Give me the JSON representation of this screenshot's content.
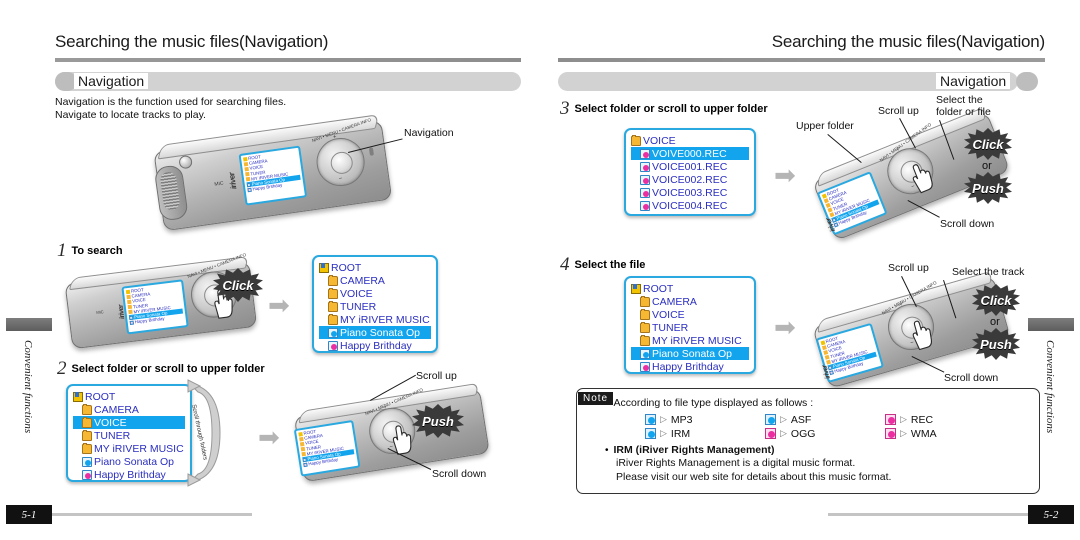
{
  "left_page": {
    "title": "Searching the music files(Navigation)",
    "section_label": "Navigation",
    "intro": "Navigation is the function used for searching files.\nNavigate to locate tracks to play.",
    "callout_navigation": "Navigation",
    "steps": [
      {
        "num": "1",
        "text": "To search"
      },
      {
        "num": "2",
        "text": "Select folder or scroll to upper folder"
      }
    ],
    "labels": {
      "click": "Click",
      "push": "Push",
      "scroll_up": "Scroll up",
      "scroll_down": "Scroll down",
      "scroll_through_folders": "Scroll through folders"
    },
    "screen_step1": {
      "rows": [
        {
          "icon": "root-icon",
          "text": "ROOT",
          "selected": false,
          "indent": false
        },
        {
          "icon": "folder-icon",
          "text": "CAMERA",
          "selected": false,
          "indent": true
        },
        {
          "icon": "folder-icon",
          "text": "VOICE",
          "selected": false,
          "indent": true
        },
        {
          "icon": "folder-icon",
          "text": "TUNER",
          "selected": false,
          "indent": true
        },
        {
          "icon": "folder-icon",
          "text": "MY iRIVER MUSIC",
          "selected": false,
          "indent": true
        },
        {
          "icon": "music-file-icon",
          "text": "Piano Sonata Op",
          "selected": true,
          "indent": true
        },
        {
          "icon": "music-file-icon-magenta",
          "text": "Happy Brithday",
          "selected": false,
          "indent": true
        }
      ]
    },
    "screen_step2": {
      "rows": [
        {
          "icon": "root-icon",
          "text": "ROOT",
          "selected": false,
          "indent": false
        },
        {
          "icon": "folder-icon",
          "text": "CAMERA",
          "selected": false,
          "indent": true
        },
        {
          "icon": "folder-icon",
          "text": "VOICE",
          "selected": true,
          "indent": true
        },
        {
          "icon": "folder-icon",
          "text": "TUNER",
          "selected": false,
          "indent": true
        },
        {
          "icon": "folder-icon",
          "text": "MY iRIVER MUSIC",
          "selected": false,
          "indent": true
        },
        {
          "icon": "music-file-icon",
          "text": "Piano Sonata Op",
          "selected": false,
          "indent": true
        },
        {
          "icon": "music-file-icon-magenta",
          "text": "Happy Brithday",
          "selected": false,
          "indent": true
        }
      ]
    },
    "page_number": "5-1",
    "side_tab": "Convenient functions"
  },
  "right_page": {
    "title": "Searching the music files(Navigation)",
    "section_label": "Navigation",
    "steps": [
      {
        "num": "3",
        "text": "Select folder or scroll to upper folder"
      },
      {
        "num": "4",
        "text": "Select the file"
      }
    ],
    "labels": {
      "upper_folder": "Upper folder",
      "scroll_up": "Scroll up",
      "select_folder_or_file": "Select the\nfolder or file",
      "select_the_track": "Select the track",
      "scroll_down": "Scroll down",
      "click": "Click",
      "push": "Push",
      "or": "or"
    },
    "screen_step3": {
      "rows": [
        {
          "icon": "folder-icon",
          "text": "VOICE",
          "selected": false,
          "indent": false
        },
        {
          "icon": "rec-file-icon",
          "text": "VOIVE000.REC",
          "selected": true,
          "indent": true
        },
        {
          "icon": "rec-file-icon",
          "text": "VOICE001.REC",
          "selected": false,
          "indent": true
        },
        {
          "icon": "rec-file-icon",
          "text": "VOICE002.REC",
          "selected": false,
          "indent": true
        },
        {
          "icon": "rec-file-icon",
          "text": "VOICE003.REC",
          "selected": false,
          "indent": true
        },
        {
          "icon": "rec-file-icon",
          "text": "VOICE004.REC",
          "selected": false,
          "indent": true
        }
      ]
    },
    "screen_step4": {
      "rows": [
        {
          "icon": "root-icon",
          "text": "ROOT",
          "selected": false,
          "indent": false
        },
        {
          "icon": "folder-icon",
          "text": "CAMERA",
          "selected": false,
          "indent": true
        },
        {
          "icon": "folder-icon",
          "text": "VOICE",
          "selected": false,
          "indent": true
        },
        {
          "icon": "folder-icon",
          "text": "TUNER",
          "selected": false,
          "indent": true
        },
        {
          "icon": "folder-icon",
          "text": "MY iRIVER MUSIC",
          "selected": false,
          "indent": true
        },
        {
          "icon": "music-file-icon",
          "text": "Piano Sonata Op",
          "selected": true,
          "indent": true
        },
        {
          "icon": "music-file-icon-magenta",
          "text": "Happy Brithday",
          "selected": false,
          "indent": true
        }
      ]
    },
    "note": {
      "tag": "Note",
      "line1": "According to file type displayed as follows :",
      "formats": [
        {
          "label": "MP3",
          "color": "cyan"
        },
        {
          "label": "ASF",
          "color": "cyan"
        },
        {
          "label": "REC",
          "color": "magenta"
        },
        {
          "label": "IRM",
          "color": "cyan"
        },
        {
          "label": "OGG",
          "color": "magenta"
        },
        {
          "label": "WMA",
          "color": "magenta"
        }
      ],
      "irm_title": "IRM (iRiver Rights Management)",
      "irm_line1": "iRiver Rights Management is a digital music format.",
      "irm_line2": "Please visit our web site for details about this music format."
    },
    "page_number": "5-2",
    "side_tab": "Convenient functions"
  },
  "device": {
    "wheel_labels": "NAVI • MENU • CAMERA INFO",
    "brand": "iriver",
    "mic_label": "MIC",
    "plus": "+",
    "minus": "−"
  },
  "colors": {
    "lcd_border": "#29a9e0",
    "lcd_selection": "#12a5ee",
    "lcd_text": "#2b2fc0",
    "folder_icon": "#f6b733",
    "magenta_icon": "#ec2fa0",
    "bar_gray": "#d2d2d2",
    "rule_gray": "#9a9a9a"
  }
}
